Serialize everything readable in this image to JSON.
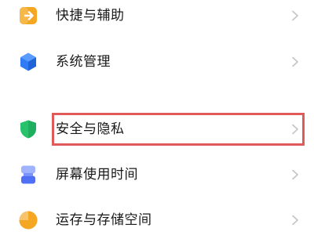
{
  "settings": {
    "items": [
      {
        "label": "快捷与辅助",
        "icon": "shortcut-arrow-icon",
        "color": "#f5a623"
      },
      {
        "label": "系统管理",
        "icon": "system-cube-icon",
        "color": "#2f7cf6"
      },
      {
        "label": "安全与隐私",
        "icon": "shield-icon",
        "color": "#27c26b"
      },
      {
        "label": "屏幕使用时间",
        "icon": "hourglass-icon",
        "color": "#5b7cfa"
      },
      {
        "label": "运存与存储空间",
        "icon": "pie-storage-icon",
        "color": "#f5a623"
      }
    ],
    "highlight_color": "#e05a59"
  }
}
